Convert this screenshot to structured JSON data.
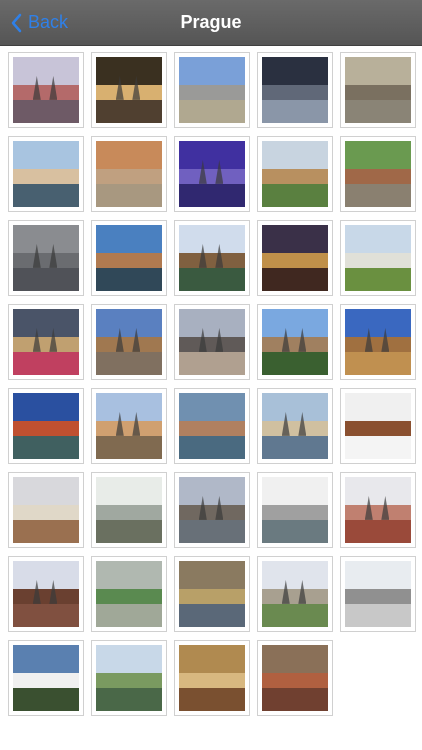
{
  "nav": {
    "back_label": "Back",
    "title": "Prague"
  },
  "gallery": {
    "photos": [
      {
        "sky": "#c8c4d8",
        "mid": "#b46a6a",
        "ground": "#6e5a66",
        "spire": true
      },
      {
        "sky": "#3a3020",
        "mid": "#d8b070",
        "ground": "#504030",
        "spire": true
      },
      {
        "sky": "#7aa0d8",
        "mid": "#9a9a98",
        "ground": "#b0a890",
        "spire": false
      },
      {
        "sky": "#2a3040",
        "mid": "#606878",
        "ground": "#8a96a8",
        "spire": false
      },
      {
        "sky": "#b8b09a",
        "mid": "#7a7060",
        "ground": "#8a8476",
        "spire": false
      },
      {
        "sky": "#a8c4e0",
        "mid": "#d8c0a0",
        "ground": "#486070",
        "spire": false
      },
      {
        "sky": "#c88a5a",
        "mid": "#c0a080",
        "ground": "#a89880",
        "spire": false
      },
      {
        "sky": "#4030a0",
        "mid": "#7060c0",
        "ground": "#302870",
        "spire": true
      },
      {
        "sky": "#c8d4e0",
        "mid": "#b89060",
        "ground": "#5a8040",
        "spire": false
      },
      {
        "sky": "#6a9a50",
        "mid": "#a06848",
        "ground": "#8a8070",
        "spire": false
      },
      {
        "sky": "#8a8c90",
        "mid": "#6a6c70",
        "ground": "#505258",
        "spire": true
      },
      {
        "sky": "#4a80c0",
        "mid": "#b07a50",
        "ground": "#304858",
        "spire": false
      },
      {
        "sky": "#d0dcec",
        "mid": "#806040",
        "ground": "#3a5a40",
        "spire": true
      },
      {
        "sky": "#3a3048",
        "mid": "#c0904a",
        "ground": "#402820",
        "spire": false
      },
      {
        "sky": "#c8d8e8",
        "mid": "#e0e0d8",
        "ground": "#6a9040",
        "spire": false
      },
      {
        "sky": "#4a5468",
        "mid": "#c0a070",
        "ground": "#c04060",
        "spire": true
      },
      {
        "sky": "#5a80c0",
        "mid": "#a07850",
        "ground": "#807060",
        "spire": true
      },
      {
        "sky": "#a8b0c0",
        "mid": "#605a58",
        "ground": "#b0a090",
        "spire": true
      },
      {
        "sky": "#7aa8e0",
        "mid": "#a08060",
        "ground": "#3a6030",
        "spire": true
      },
      {
        "sky": "#3a68c0",
        "mid": "#a07040",
        "ground": "#c09050",
        "spire": true
      },
      {
        "sky": "#2a50a0",
        "mid": "#c05030",
        "ground": "#406060",
        "spire": false
      },
      {
        "sky": "#a8c0e0",
        "mid": "#d0a070",
        "ground": "#806a50",
        "spire": true
      },
      {
        "sky": "#7090b0",
        "mid": "#b08060",
        "ground": "#4a6a80",
        "spire": false
      },
      {
        "sky": "#a8c0d8",
        "mid": "#d0c0a0",
        "ground": "#607890",
        "spire": true
      },
      {
        "sky": "#f0f0f0",
        "mid": "#8a5030",
        "ground": "#f4f4f4",
        "spire": false
      },
      {
        "sky": "#d8d8dc",
        "mid": "#e0d8c8",
        "ground": "#9a7050",
        "spire": false
      },
      {
        "sky": "#e8ece8",
        "mid": "#a0a8a0",
        "ground": "#6a7060",
        "spire": false
      },
      {
        "sky": "#b0b8c8",
        "mid": "#706860",
        "ground": "#687078",
        "spire": true
      },
      {
        "sky": "#f0f0f0",
        "mid": "#a0a0a0",
        "ground": "#6a7a80",
        "spire": false
      },
      {
        "sky": "#e8e8ec",
        "mid": "#c08070",
        "ground": "#9a4a3a",
        "spire": true
      },
      {
        "sky": "#d8dce8",
        "mid": "#6a4030",
        "ground": "#805040",
        "spire": true
      },
      {
        "sky": "#b0b8b0",
        "mid": "#5a8a50",
        "ground": "#a0a898",
        "spire": false
      },
      {
        "sky": "#8a7a60",
        "mid": "#b8a068",
        "ground": "#5a6878",
        "spire": false
      },
      {
        "sky": "#e0e4ec",
        "mid": "#a8a090",
        "ground": "#6a8a50",
        "spire": true
      },
      {
        "sky": "#e8ecf0",
        "mid": "#909090",
        "ground": "#c8c8c8",
        "spire": false
      },
      {
        "sky": "#5a80b0",
        "mid": "#f0f0f0",
        "ground": "#3a5030",
        "spire": false
      },
      {
        "sky": "#c8d8e8",
        "mid": "#7a9a60",
        "ground": "#4a6848",
        "spire": false
      },
      {
        "sky": "#b08a50",
        "mid": "#d8b880",
        "ground": "#7a5030",
        "spire": false
      },
      {
        "sky": "#8a7058",
        "mid": "#b06040",
        "ground": "#704030",
        "spire": false
      }
    ]
  }
}
